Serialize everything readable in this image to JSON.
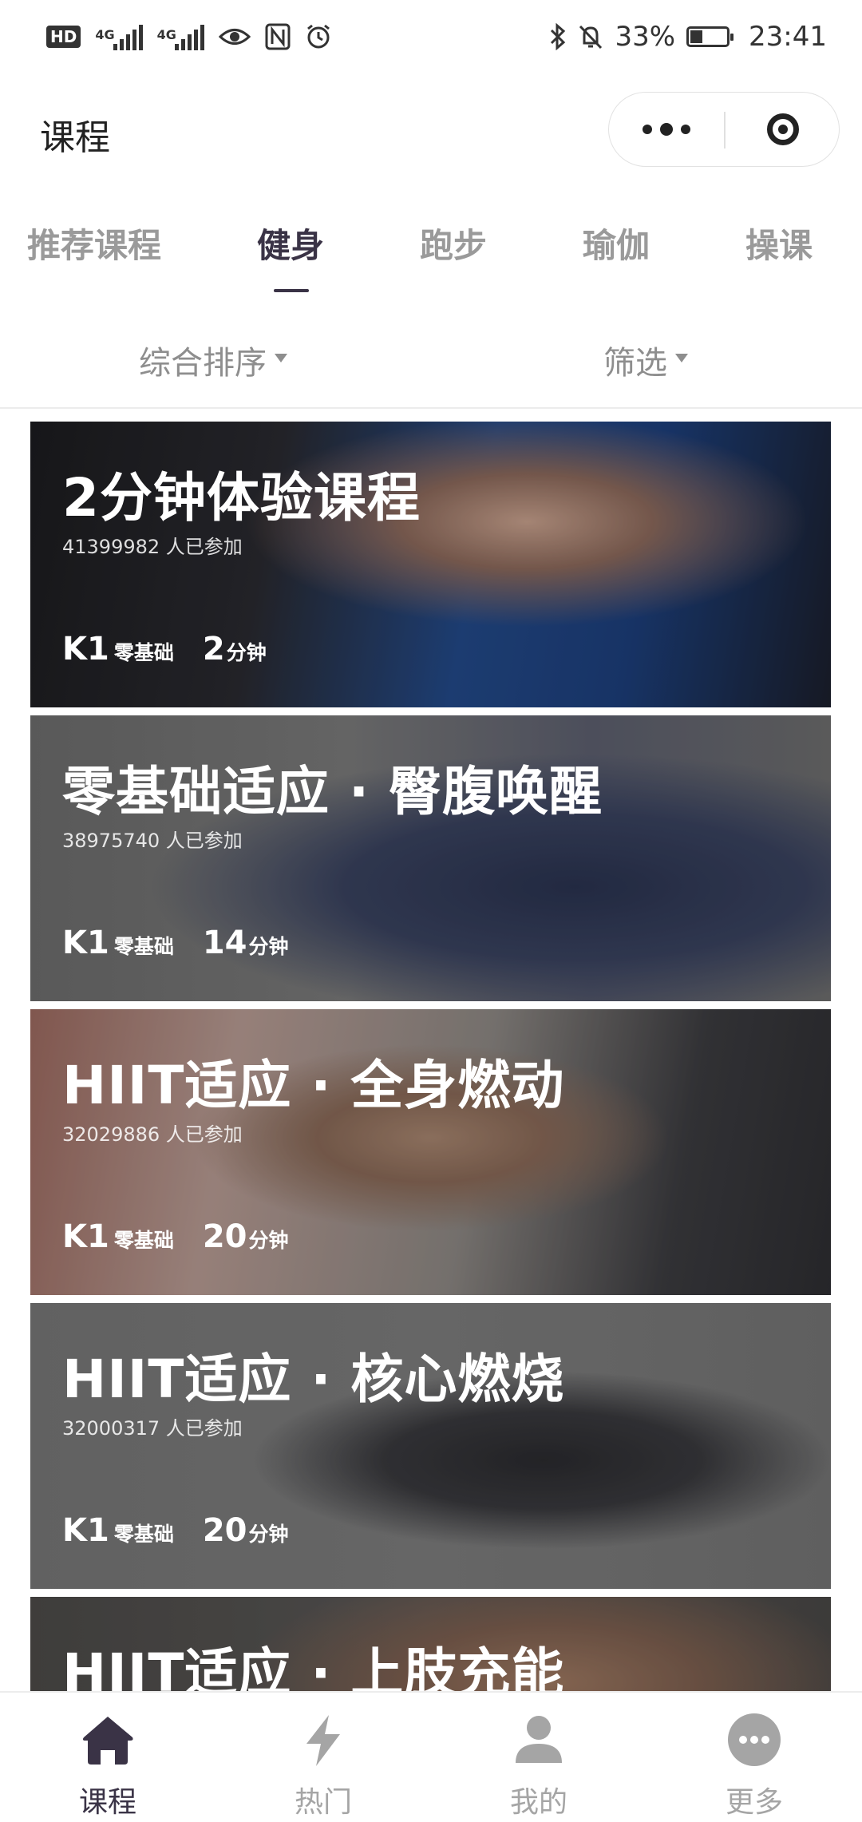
{
  "status_bar": {
    "hd": "HD",
    "sig1": "4G",
    "sig2": "4G",
    "battery": "33%",
    "time": "23:41",
    "battery_level": 0.33
  },
  "header": {
    "title": "课程",
    "capsule": {
      "more_icon": "more-dots-icon",
      "close_icon": "target-close-icon"
    }
  },
  "tabs": {
    "items": [
      {
        "label": "推荐课程"
      },
      {
        "label": "健身"
      },
      {
        "label": "跑步"
      },
      {
        "label": "瑜伽"
      },
      {
        "label": "操课"
      }
    ],
    "active_index": 1
  },
  "sort_bar": {
    "sort_label": "综合排序",
    "filter_label": "筛选"
  },
  "courses": [
    {
      "title": "2分钟体验课程",
      "participants": "41399982 人已参加",
      "level_code": "K1",
      "level_name": "零基础",
      "duration_value": "2",
      "duration_unit": "分钟"
    },
    {
      "title": "零基础适应 · 臀腹唤醒",
      "participants": "38975740 人已参加",
      "level_code": "K1",
      "level_name": "零基础",
      "duration_value": "14",
      "duration_unit": "分钟"
    },
    {
      "title": "HIIT适应 · 全身燃动",
      "participants": "32029886 人已参加",
      "level_code": "K1",
      "level_name": "零基础",
      "duration_value": "20",
      "duration_unit": "分钟"
    },
    {
      "title": "HIIT适应 · 核心燃烧",
      "participants": "32000317 人已参加",
      "level_code": "K1",
      "level_name": "零基础",
      "duration_value": "20",
      "duration_unit": "分钟"
    },
    {
      "title": "HIIT适应 · 上肢充能",
      "participants": "",
      "level_code": "",
      "level_name": "",
      "duration_value": "",
      "duration_unit": ""
    }
  ],
  "tabbar": {
    "items": [
      {
        "label": "课程",
        "icon": "home-icon"
      },
      {
        "label": "热门",
        "icon": "lightning-icon"
      },
      {
        "label": "我的",
        "icon": "person-icon"
      },
      {
        "label": "更多",
        "icon": "more-circle-icon"
      }
    ],
    "active_index": 0
  },
  "colors": {
    "accent": "#3a3346",
    "inactive": "#a5a5a5"
  }
}
